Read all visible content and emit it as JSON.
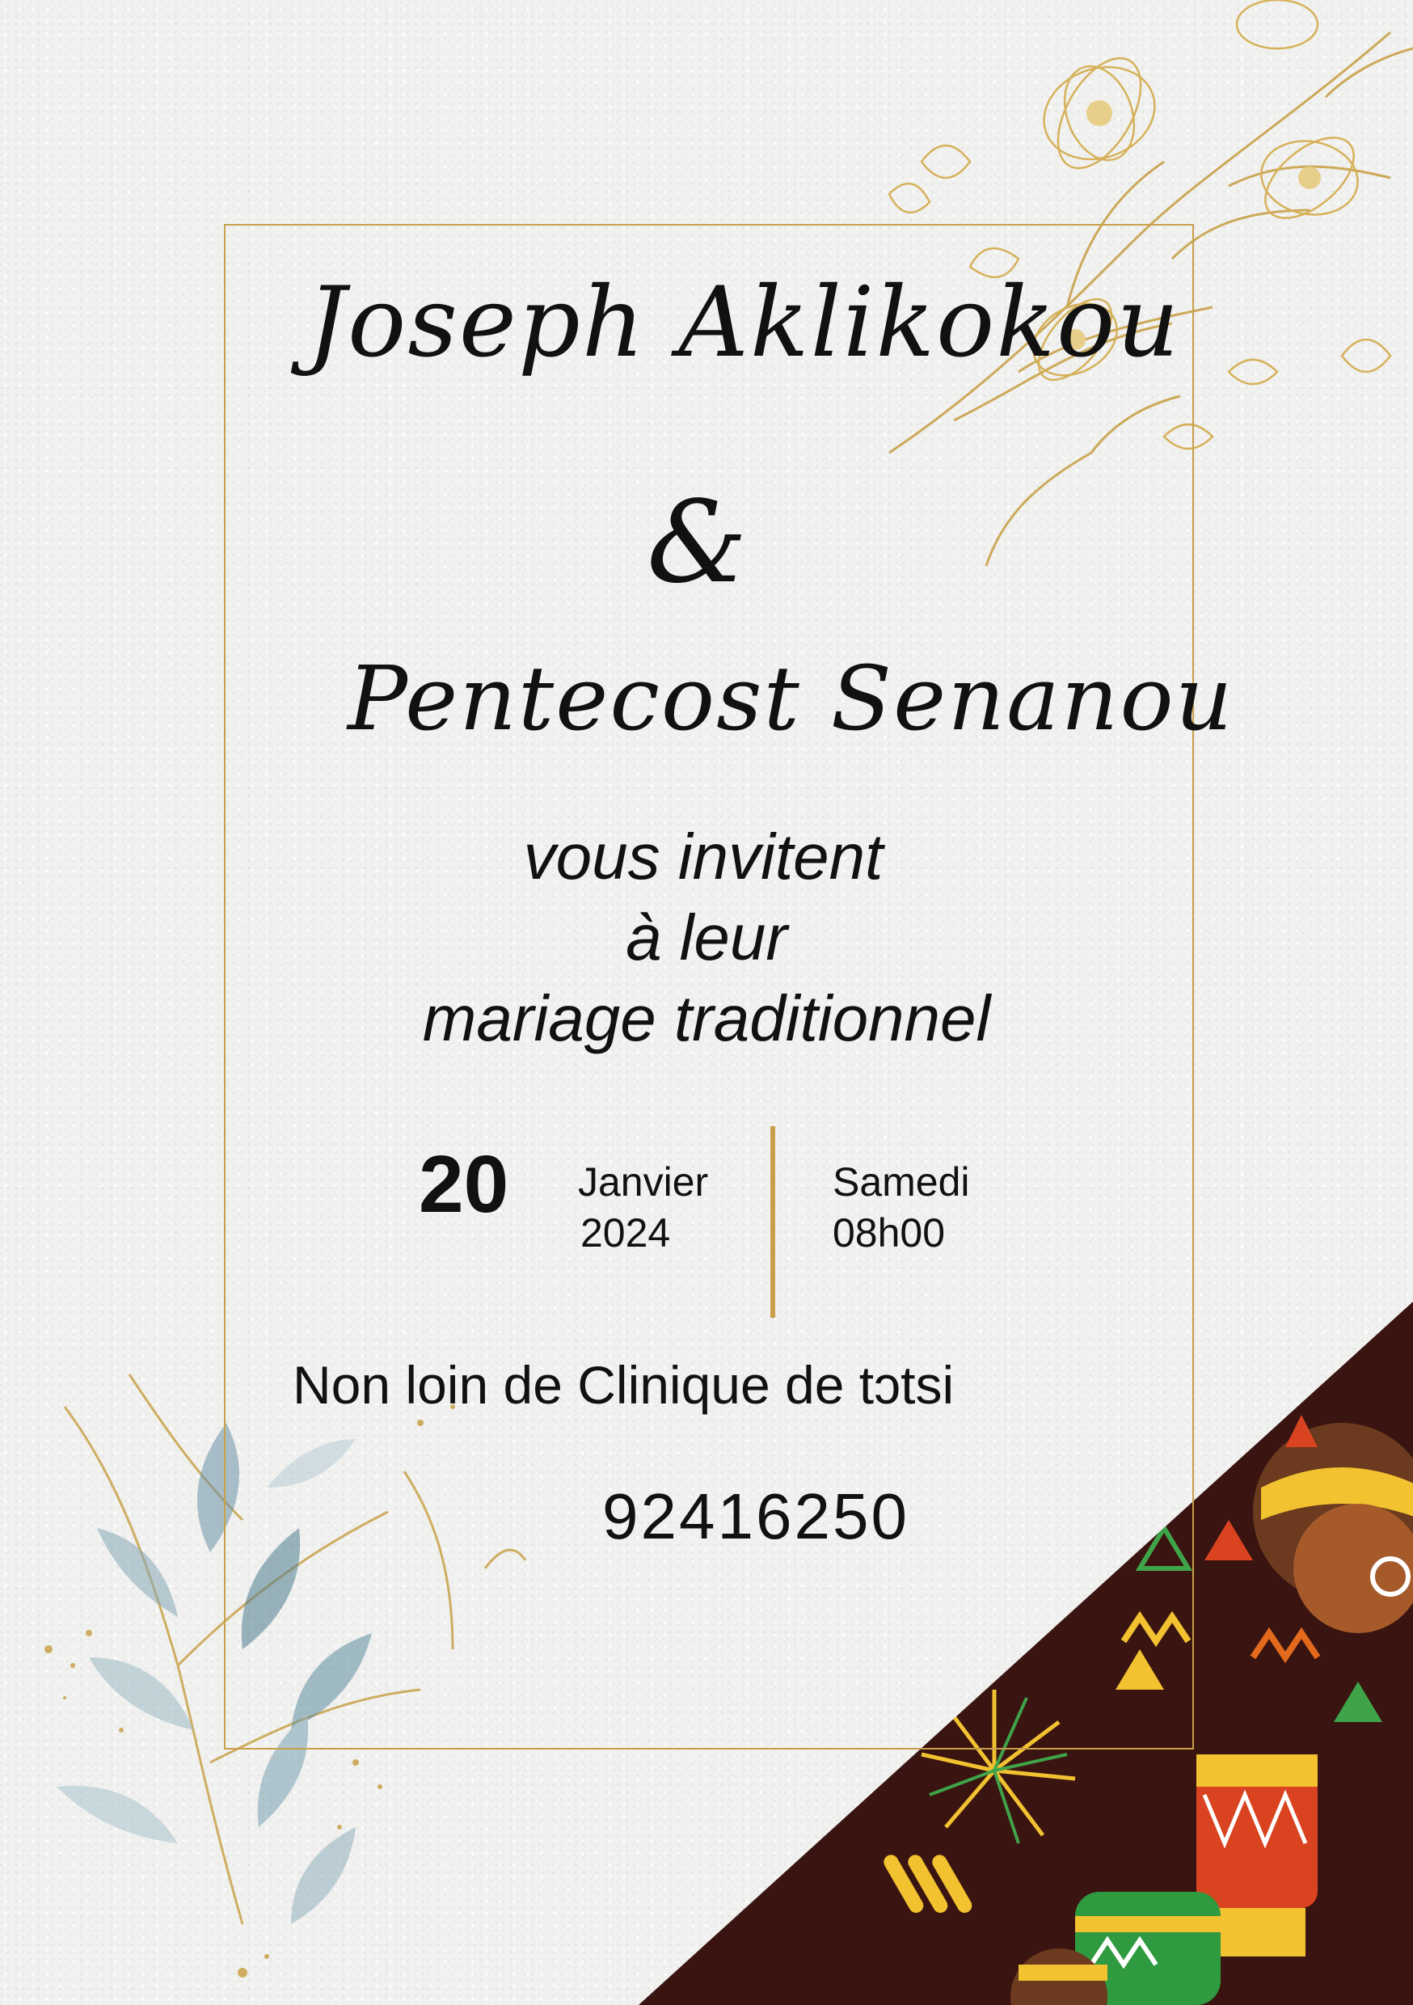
{
  "invitation": {
    "groom": "Joseph Aklikokou",
    "ampersand": "&",
    "bride": "Pentecost Senanou",
    "invite_lines": [
      "vous invitent",
      "à leur",
      "mariage traditionnel"
    ],
    "date": {
      "day": "20",
      "month": "Janvier",
      "year": "2024",
      "weekday": "Samedi",
      "time": "08h00"
    },
    "venue": "Non loin de Clinique de tɔtsi",
    "phone": "92416250"
  },
  "colors": {
    "paper": "#f1f1f0",
    "gold": "#c8a04a",
    "text": "#111111",
    "pattern_bg": "#3a1410"
  },
  "decorations": {
    "top_right": "gold-flower-illustration",
    "bottom_left": "watercolor-eucalyptus-leaves",
    "bottom_right": "african-pattern-corner-panel"
  }
}
